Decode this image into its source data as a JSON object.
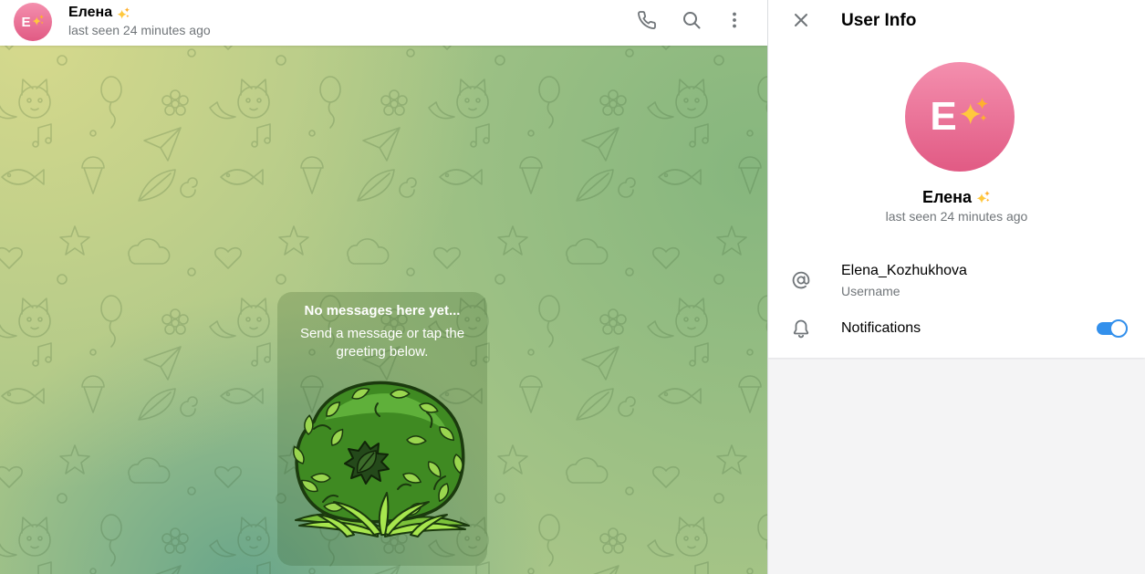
{
  "chat_header": {
    "avatar": {
      "letter": "E",
      "emoji": "✨"
    },
    "name": "Елена",
    "name_emoji": "✨",
    "status": "last seen 24 minutes ago",
    "icons": {
      "call": "phone-icon",
      "search": "search-icon",
      "more": "more-vertical-icon"
    }
  },
  "empty_state": {
    "title": "No messages here yet...",
    "subtitle": "Send a message or tap the greeting below."
  },
  "user_info": {
    "title": "User Info",
    "close_icon": "close-icon",
    "avatar": {
      "letter": "E",
      "emoji": "✨"
    },
    "name": "Елена",
    "name_emoji": "✨",
    "status": "last seen 24 minutes ago",
    "username": {
      "icon": "at-icon",
      "value": "Elena_Kozhukhova",
      "label": "Username"
    },
    "notifications": {
      "icon": "bell-icon",
      "label": "Notifications",
      "enabled": true
    }
  },
  "colors": {
    "accent": "#3390ec",
    "secondary_text": "#707579",
    "avatar_top": "#f48fae",
    "avatar_bottom": "#e15a84",
    "wallpaper": {
      "top_left": "#d6d98c",
      "right": "#86b67e",
      "bottom": "#66a48b",
      "base": "#a9c688"
    }
  }
}
